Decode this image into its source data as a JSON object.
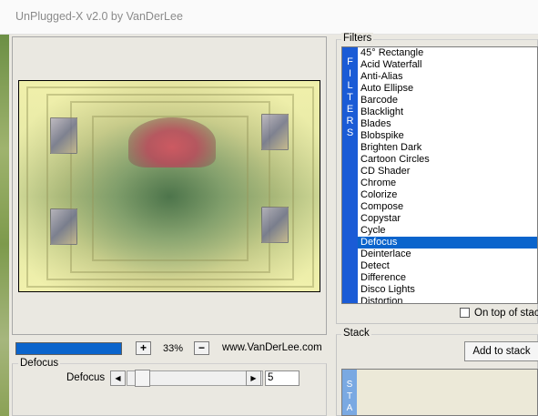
{
  "window": {
    "title": "UnPlugged-X v2.0 by VanDerLee"
  },
  "preview": {
    "progress_percent": 100
  },
  "zoom": {
    "plus_label": "+",
    "minus_label": "−",
    "level": "33%"
  },
  "website": "www.VanDerLee.com",
  "parameters": {
    "group_title": "Defocus",
    "slider_label": "Defocus",
    "value": "5",
    "left_arrow": "◀",
    "right_arrow": "▶"
  },
  "filters": {
    "group_title": "Filters",
    "band_letters": [
      "F",
      "I",
      "L",
      "T",
      "E",
      "R",
      "S"
    ],
    "selected": "Defocus",
    "items": [
      "45° Rectangle",
      "Acid Waterfall",
      "Anti-Alias",
      "Auto Ellipse",
      "Barcode",
      "Blacklight",
      "Blades",
      "Blobspike",
      "Brighten Dark",
      "Cartoon Circles",
      "CD Shader",
      "Chrome",
      "Colorize",
      "Compose",
      "Copystar",
      "Cycle",
      "Defocus",
      "Deinterlace",
      "Detect",
      "Difference",
      "Disco Lights",
      "Distortion"
    ],
    "on_top_label": "On top of stack",
    "on_top_checked": false
  },
  "stack": {
    "group_title": "Stack",
    "add_label": "Add to stack",
    "band_letters": [
      "S",
      "T",
      "A"
    ]
  },
  "colors": {
    "accent": "#0a64cc",
    "band": "#1a5bd6"
  }
}
